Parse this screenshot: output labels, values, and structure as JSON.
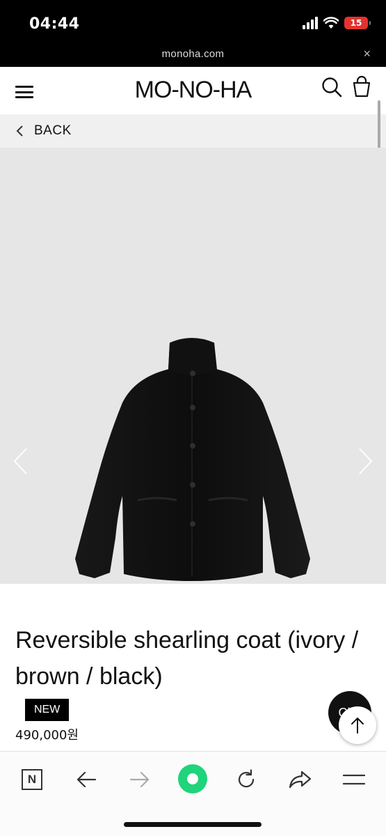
{
  "status_bar": {
    "time": "04:44",
    "battery": "15"
  },
  "url_bar": {
    "domain": "monoha.com",
    "close": "×"
  },
  "header": {
    "logo": "MO-NO-HA"
  },
  "back": {
    "label": "BACK"
  },
  "product": {
    "title": "Reversible shearling coat (ivory / brown / black)",
    "badge": "NEW",
    "price": "490,000원"
  },
  "floating": {
    "chat_label": "Ch"
  },
  "toolbar": {
    "n_label": "N"
  },
  "colors": {
    "accent_green": "#1fd47a",
    "battery_red": "#e5322f"
  },
  "icons": [
    "hamburger-icon",
    "search-icon",
    "shopping-bag-icon",
    "chevron-left-icon",
    "chevron-right-icon",
    "arrow-up-icon",
    "back-arrow-icon",
    "forward-arrow-icon",
    "reload-icon",
    "share-icon",
    "menu-icon"
  ]
}
